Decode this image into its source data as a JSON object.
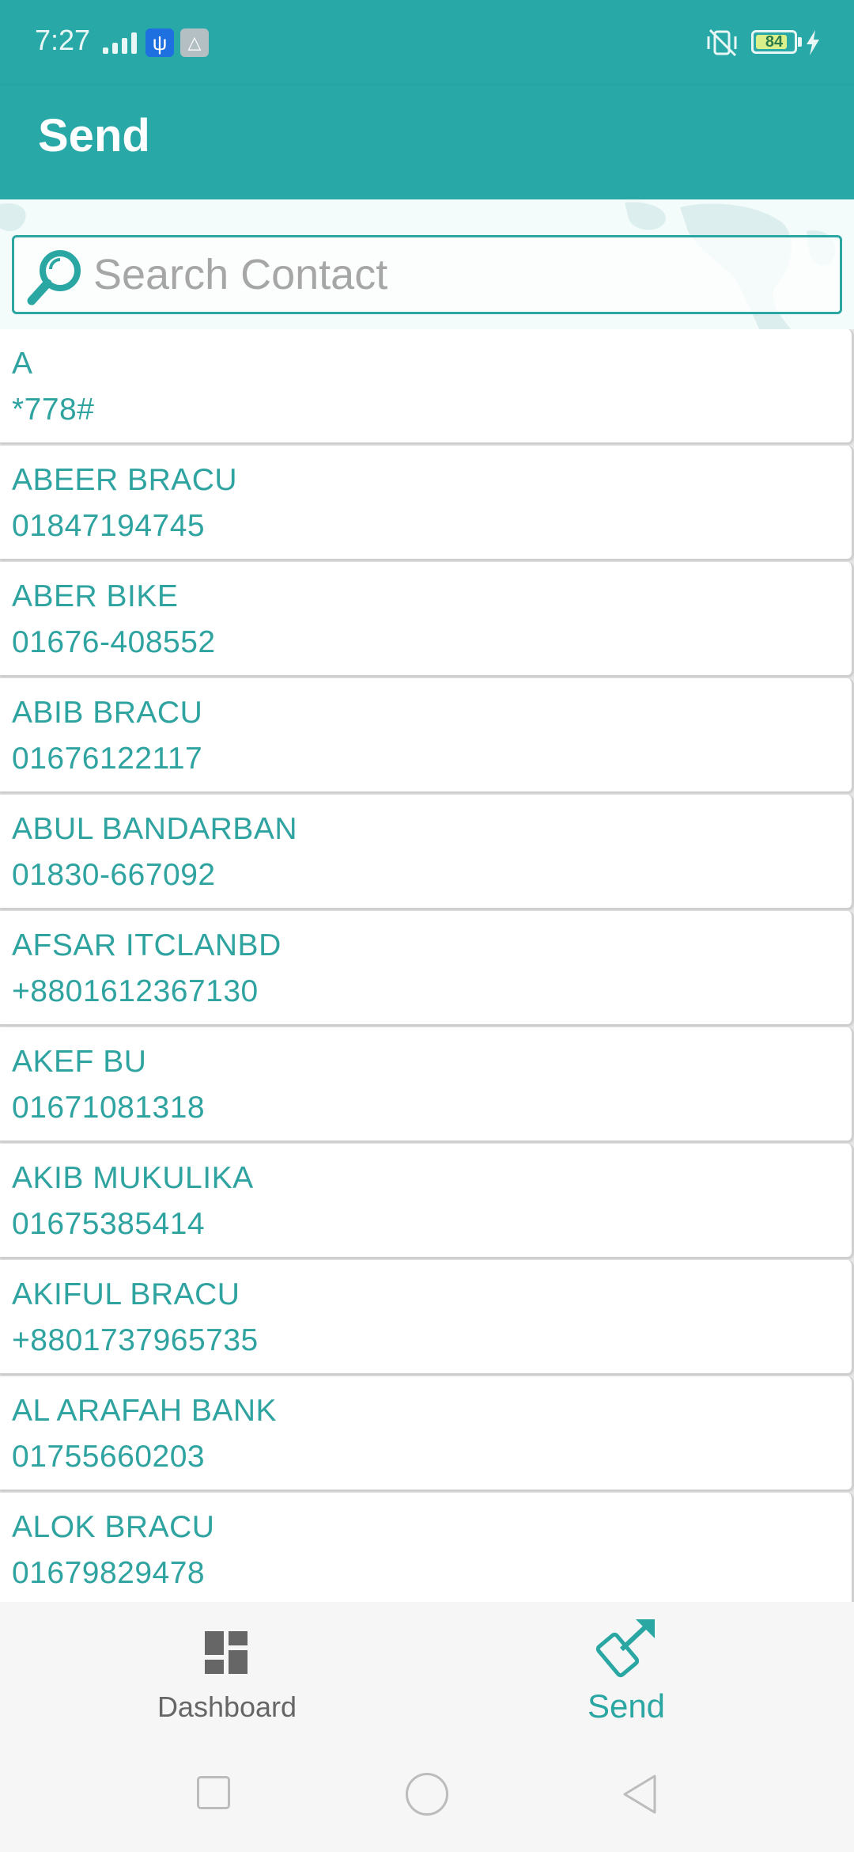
{
  "status_bar": {
    "time": "7:27",
    "battery_level": "84",
    "battery_fraction": 0.84,
    "icons": [
      "signal-icon",
      "usb-icon",
      "system-icon",
      "vibrate-off-icon",
      "battery-icon",
      "charging-icon"
    ]
  },
  "app_bar": {
    "title": "Send"
  },
  "search": {
    "placeholder": "Search Contact",
    "value": ""
  },
  "contacts": [
    {
      "name": "A",
      "number": "*778#"
    },
    {
      "name": "ABEER BRACU",
      "number": "01847194745"
    },
    {
      "name": "ABER BIKE",
      "number": "01676-408552"
    },
    {
      "name": "ABIB BRACU",
      "number": "01676122117"
    },
    {
      "name": "ABUL BANDARBAN",
      "number": "01830-667092"
    },
    {
      "name": "AFSAR ITCLANBD",
      "number": "+8801612367130"
    },
    {
      "name": "AKEF BU",
      "number": "01671081318"
    },
    {
      "name": "AKIB MUKULIKA",
      "number": "01675385414"
    },
    {
      "name": "AKIFUL BRACU",
      "number": "+8801737965735"
    },
    {
      "name": "AL ARAFAH BANK",
      "number": "01755660203"
    },
    {
      "name": "ALOK BRACU",
      "number": "01679829478"
    }
  ],
  "bottom_nav": {
    "dashboard_label": "Dashboard",
    "send_label": "Send",
    "active": "Send"
  },
  "colors": {
    "primary": "#28a8a6",
    "accent_text": "#2ea3a0",
    "inactive_nav": "#666666"
  }
}
